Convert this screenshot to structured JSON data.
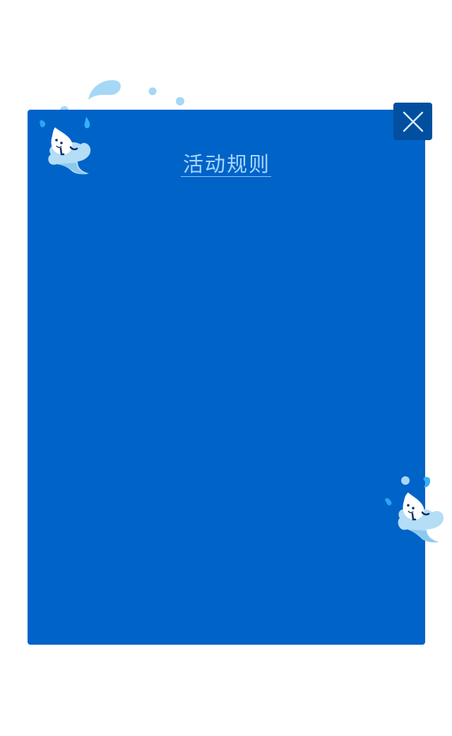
{
  "dialog": {
    "title": "活动规则",
    "close_icon": "close-icon",
    "background_color": "#0063c8",
    "close_button_color": "#024f9f",
    "title_color": "#a8d6ff"
  },
  "decorations": {
    "mascot_icon": "water-drop-mascot-icon",
    "splash_color": "#a6d7f7"
  }
}
